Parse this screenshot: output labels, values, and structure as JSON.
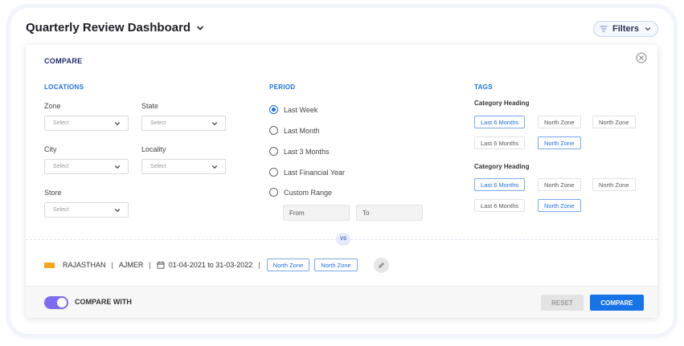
{
  "header": {
    "title": "Quarterly Review Dashboard",
    "filters_label": "Filters"
  },
  "compare_panel": {
    "title": "COMPARE",
    "locations": {
      "heading": "LOCATIONS",
      "zone_label": "Zone",
      "state_label": "State",
      "city_label": "City",
      "locality_label": "Locality",
      "store_label": "Store",
      "select_placeholder": "Select"
    },
    "period": {
      "heading": "PERIOD",
      "options": [
        "Last Week",
        "Last Month",
        "Last 3 Months",
        "Last Financial Year",
        "Custom Range"
      ],
      "selected": "Last Week",
      "from_label": "From",
      "to_label": "To"
    },
    "tags": {
      "heading": "TAGS",
      "groups": [
        {
          "heading": "Category Heading",
          "row1": [
            "Last 6 Months",
            "North Zone",
            "North Zone"
          ],
          "row2": [
            "Last 6 Months",
            "North Zone"
          ]
        },
        {
          "heading": "Category Heading",
          "row1": [
            "Last 6 Months",
            "North Zone",
            "North Zone"
          ],
          "row2": [
            "Last 6 Months",
            "North Zone"
          ]
        }
      ]
    },
    "vs_label": "VS",
    "summary": {
      "state": "RAJASTHAN",
      "city": "AJMER",
      "date_range": "01-04-2021 to 31-03-2022",
      "tags": [
        "North Zone",
        "North Zone"
      ]
    },
    "footer": {
      "compare_with_label": "COMPARE WITH",
      "compare_with_on": true,
      "reset_label": "RESET",
      "compare_label": "COMPARE"
    }
  },
  "colors": {
    "accent": "#1a6fdf",
    "toggle": "#7b6cf0",
    "flag": "#f5a51c",
    "primary_button": "#1773e8"
  }
}
